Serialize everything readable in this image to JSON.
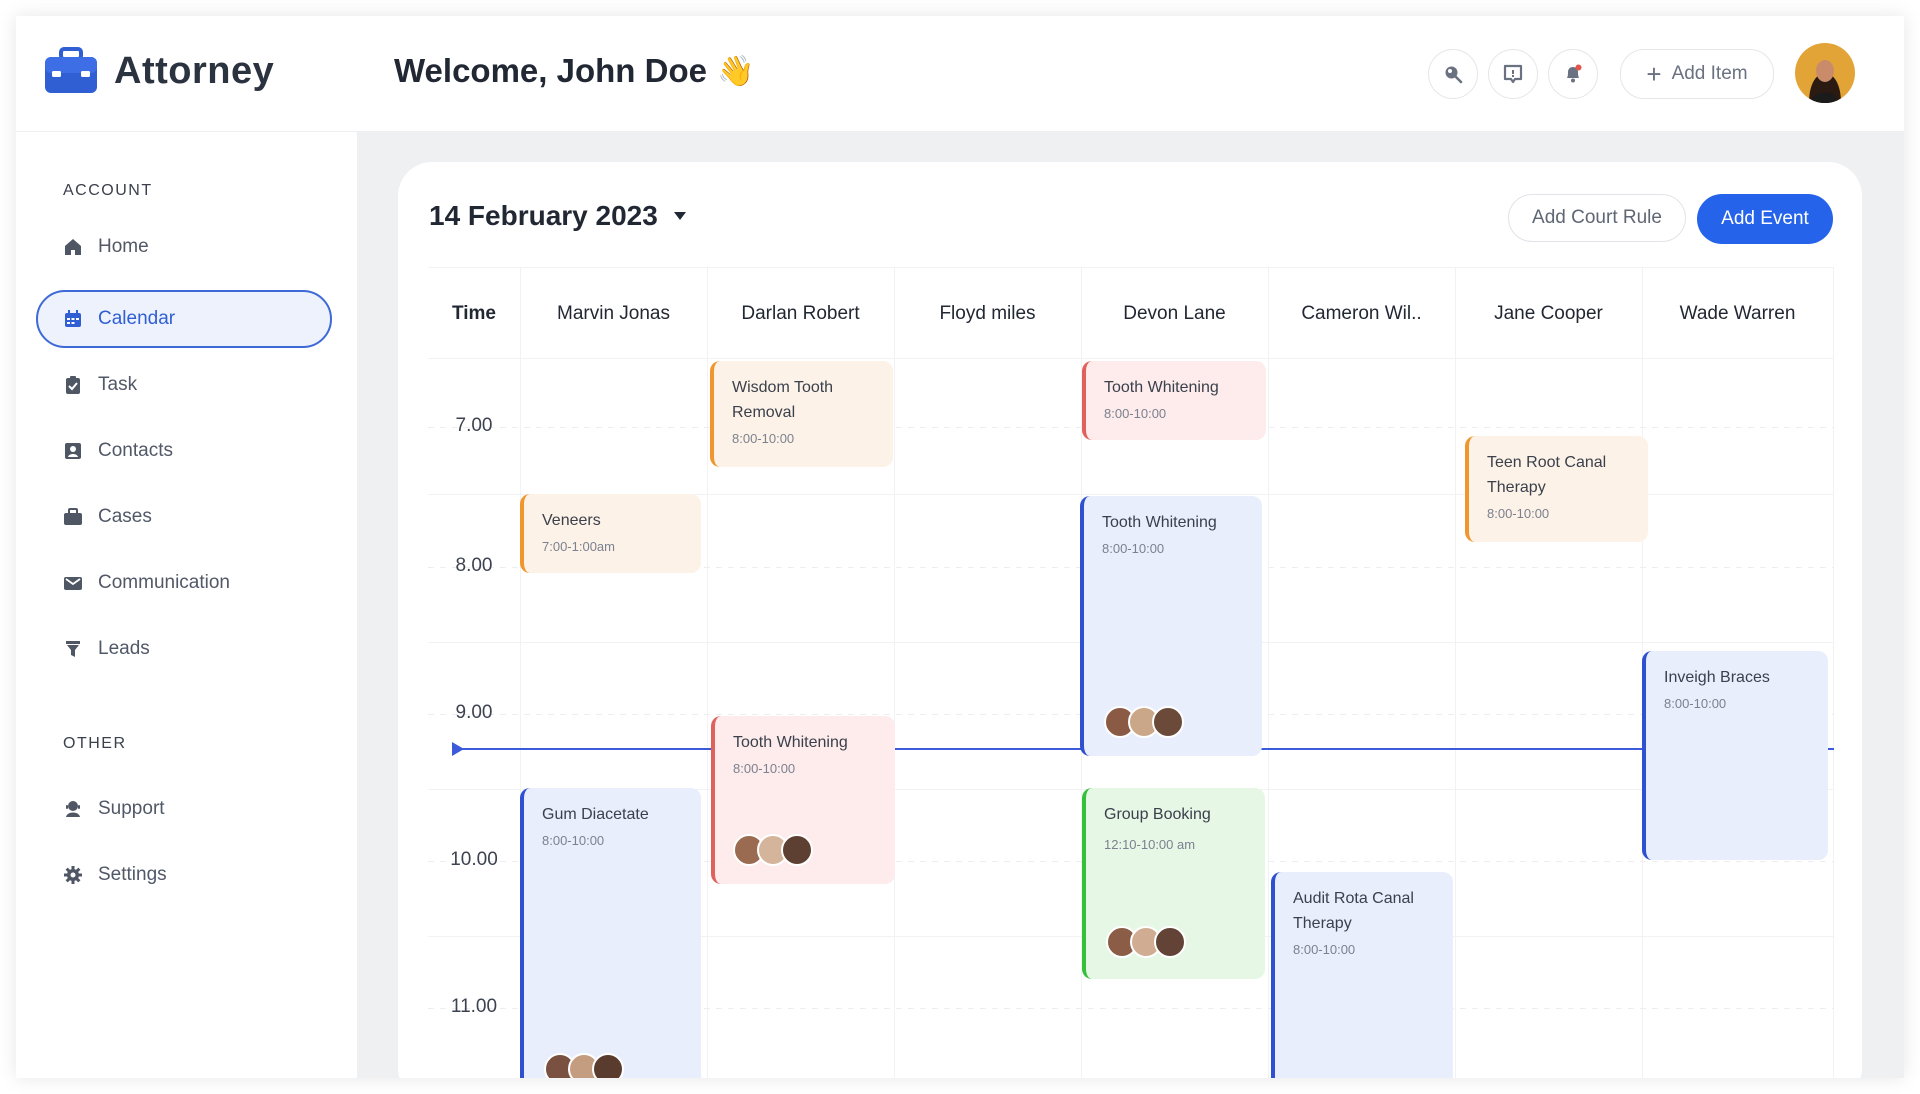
{
  "app": {
    "name": "Attorney"
  },
  "header": {
    "welcome": "Welcome, John Doe",
    "wave_emoji": "👋",
    "add_item_label": "Add Item",
    "icons": [
      "search-icon",
      "chat-icon",
      "notification-bell-icon"
    ]
  },
  "sidebar": {
    "account_label": "ACCOUNT",
    "other_label": "OTHER",
    "items": [
      {
        "label": "Home",
        "icon": "home-icon"
      },
      {
        "label": "Calendar",
        "icon": "calendar-icon",
        "active": true
      },
      {
        "label": "Task",
        "icon": "task-icon"
      },
      {
        "label": "Contacts",
        "icon": "contacts-icon"
      },
      {
        "label": "Cases",
        "icon": "briefcase-icon"
      },
      {
        "label": "Communication",
        "icon": "mail-icon"
      },
      {
        "label": "Leads",
        "icon": "filter-icon"
      }
    ],
    "other_items": [
      {
        "label": "Support",
        "icon": "support-icon"
      },
      {
        "label": "Settings",
        "icon": "gear-icon"
      }
    ]
  },
  "calendar": {
    "date": "14 February 2023",
    "add_court_rule_label": "Add Court Rule",
    "add_event_label": "Add Event",
    "time_header": "Time",
    "columns": [
      "Marvin Jonas",
      "Darlan Robert",
      "Floyd miles",
      "Devon Lane",
      "Cameron Wil..",
      "Jane Cooper",
      "Wade Warren"
    ],
    "times": [
      "7.00",
      "8.00",
      "9.00",
      "10.00",
      "11.00"
    ],
    "events": [
      {
        "title": "Wisdom Tooth Removal",
        "time": "8:00-10:00",
        "column": "Darlan Robert",
        "color": "orange"
      },
      {
        "title": "Tooth Whitening",
        "time": "8:00-10:00",
        "column": "Devon Lane",
        "color": "red"
      },
      {
        "title": "Teen Root Canal Therapy",
        "time": "8:00-10:00",
        "column": "Jane Cooper",
        "color": "orange"
      },
      {
        "title": "Veneers",
        "time": "7:00-1:00am",
        "column": "Marvin Jonas",
        "color": "orange"
      },
      {
        "title": "Tooth Whitening",
        "time": "8:00-10:00",
        "column": "Devon Lane",
        "color": "blue"
      },
      {
        "title": "Inveigh Braces",
        "time": "8:00-10:00",
        "column": "Wade Warren",
        "color": "blue"
      },
      {
        "title": "Tooth Whitening",
        "time": "8:00-10:00",
        "column": "Darlan Robert",
        "color": "red"
      },
      {
        "title": "Gum Diacetate",
        "time": "8:00-10:00",
        "column": "Marvin Jonas",
        "color": "blue"
      },
      {
        "title": "Group Booking",
        "time": "12:10-10:00 am",
        "column": "Devon Lane",
        "color": "green"
      },
      {
        "title": "Audit Rota Canal Therapy",
        "time": "8:00-10:00",
        "column": "Cameron Wil..",
        "color": "blue"
      }
    ]
  },
  "colors": {
    "primary": "#2563eb",
    "active_nav_bg": "#eef2fd",
    "orange_event": "#f0962e",
    "red_event": "#e0615c",
    "blue_event": "#2f50d0",
    "green_event": "#35c03a",
    "now_line": "#3b5bdb"
  }
}
